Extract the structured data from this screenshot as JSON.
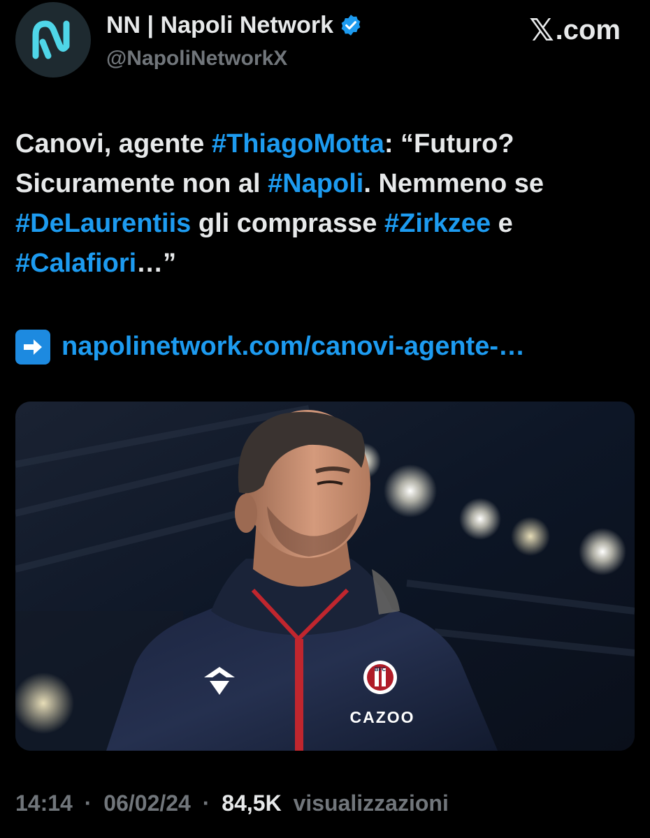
{
  "author": {
    "display_name": "NN | Napoli Network",
    "handle": "@NapoliNetworkX",
    "avatar_icon": "napoli-network-logo-icon",
    "verified_icon": "verified-badge-icon",
    "verified_color": "#1d9bf0"
  },
  "brand": {
    "label": ".com",
    "icon": "x-logo-icon"
  },
  "tweet": {
    "segments": [
      {
        "text": "Canovi, agente ",
        "type": "text"
      },
      {
        "text": "#ThiagoMotta",
        "type": "hashtag"
      },
      {
        "text": ": “Futuro? Sicuramente non al ",
        "type": "text"
      },
      {
        "text": "#Napoli",
        "type": "hashtag"
      },
      {
        "text": ". Nemmeno se ",
        "type": "text"
      },
      {
        "text": "#DeLaurentiis",
        "type": "hashtag"
      },
      {
        "text": " gli comprasse ",
        "type": "text"
      },
      {
        "text": "#Zirkzee",
        "type": "hashtag"
      },
      {
        "text": " e ",
        "type": "text"
      },
      {
        "text": "#Calafiori",
        "type": "hashtag"
      },
      {
        "text": "…”",
        "type": "text"
      }
    ],
    "link_icon": "right-arrow-emoji-icon",
    "link_text": "napolinetwork.com/canovi-agente-…"
  },
  "media": {
    "icon": "photo-icon",
    "crest_text": "BFC",
    "sponsor_text": "CAZOO"
  },
  "meta": {
    "time": "14:14",
    "separator": "·",
    "date": "06/02/24",
    "views_count": "84,5K",
    "views_label": "visualizzazioni"
  },
  "colors": {
    "background": "#000000",
    "text": "#e7e9ea",
    "secondary": "#71767b",
    "link": "#1d9bf0"
  }
}
